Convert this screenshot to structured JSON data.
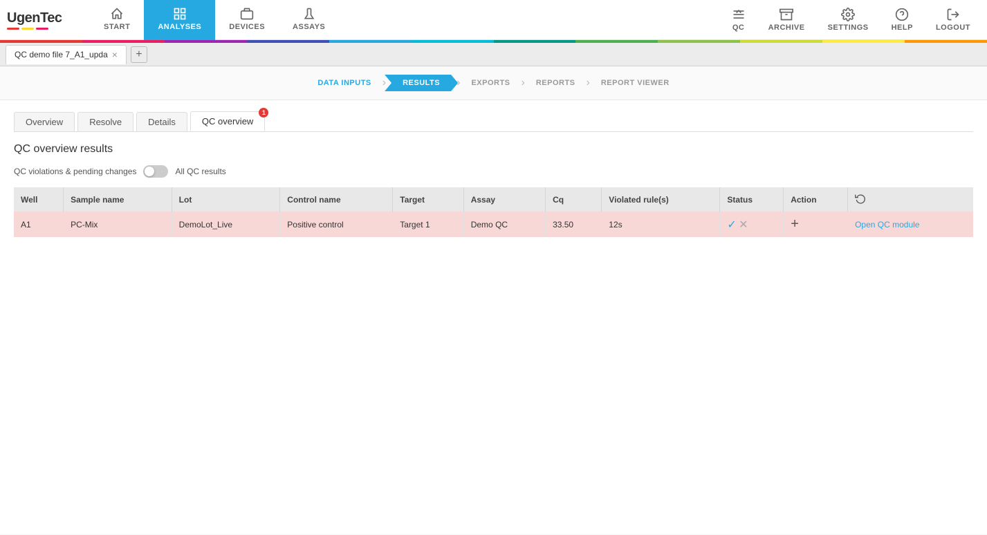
{
  "app": {
    "logo": "UgenTec",
    "logo_bars": [
      "red",
      "yellow",
      "pink"
    ]
  },
  "nav": {
    "items": [
      {
        "id": "start",
        "label": "START",
        "icon": "home"
      },
      {
        "id": "analyses",
        "label": "ANALYSES",
        "icon": "analyses",
        "active": true
      },
      {
        "id": "devices",
        "label": "DEVICES",
        "icon": "devices"
      },
      {
        "id": "assays",
        "label": "ASSAYS",
        "icon": "assays"
      }
    ],
    "right_items": [
      {
        "id": "qc",
        "label": "QC",
        "icon": "qc"
      },
      {
        "id": "archive",
        "label": "ARCHIVE",
        "icon": "archive"
      },
      {
        "id": "settings",
        "label": "SETTINGS",
        "icon": "settings"
      },
      {
        "id": "help",
        "label": "HELP",
        "icon": "help"
      },
      {
        "id": "logout",
        "label": "LOGOUT",
        "icon": "logout"
      }
    ]
  },
  "rainbow": [
    "#e53935",
    "#e91e63",
    "#9c27b0",
    "#3f51b5",
    "#26a9e0",
    "#00bcd4",
    "#009688",
    "#4caf50",
    "#8bc34a",
    "#cddc39",
    "#ffeb3b",
    "#ff9800"
  ],
  "tab": {
    "title": "QC demo file 7_A1_upda",
    "add_label": "+"
  },
  "workflow": {
    "steps": [
      {
        "id": "data-inputs",
        "label": "DATA INPUTS",
        "state": "done"
      },
      {
        "id": "results",
        "label": "RESULTS",
        "state": "active"
      },
      {
        "id": "exports",
        "label": "EXPORTS",
        "state": "pending"
      },
      {
        "id": "reports",
        "label": "REPORTS",
        "state": "pending"
      },
      {
        "id": "report-viewer",
        "label": "REPORT VIEWER",
        "state": "pending"
      }
    ]
  },
  "sub_tabs": [
    {
      "id": "overview",
      "label": "Overview",
      "active": false,
      "badge": null
    },
    {
      "id": "resolve",
      "label": "Resolve",
      "active": false,
      "badge": null
    },
    {
      "id": "details",
      "label": "Details",
      "active": false,
      "badge": null
    },
    {
      "id": "qc-overview",
      "label": "QC overview",
      "active": true,
      "badge": "1"
    }
  ],
  "page_title": "QC overview results",
  "filter": {
    "label": "QC violations & pending changes",
    "toggle_state": "off",
    "all_qc_label": "All QC results"
  },
  "table": {
    "headers": [
      "Well",
      "Sample name",
      "Lot",
      "Control name",
      "Target",
      "Assay",
      "Cq",
      "Violated rule(s)",
      "Status",
      "Action",
      ""
    ],
    "rows": [
      {
        "well": "A1",
        "sample_name": "PC-Mix",
        "lot": "DemoLot_Live",
        "control_name": "Positive control",
        "target": "Target 1",
        "assay": "Demo QC",
        "cq": "33.50",
        "violated_rules": "12s",
        "status_check": "✓",
        "status_x": "✕",
        "action_plus": "+",
        "action_link": "Open QC module",
        "is_violation": true
      }
    ]
  }
}
